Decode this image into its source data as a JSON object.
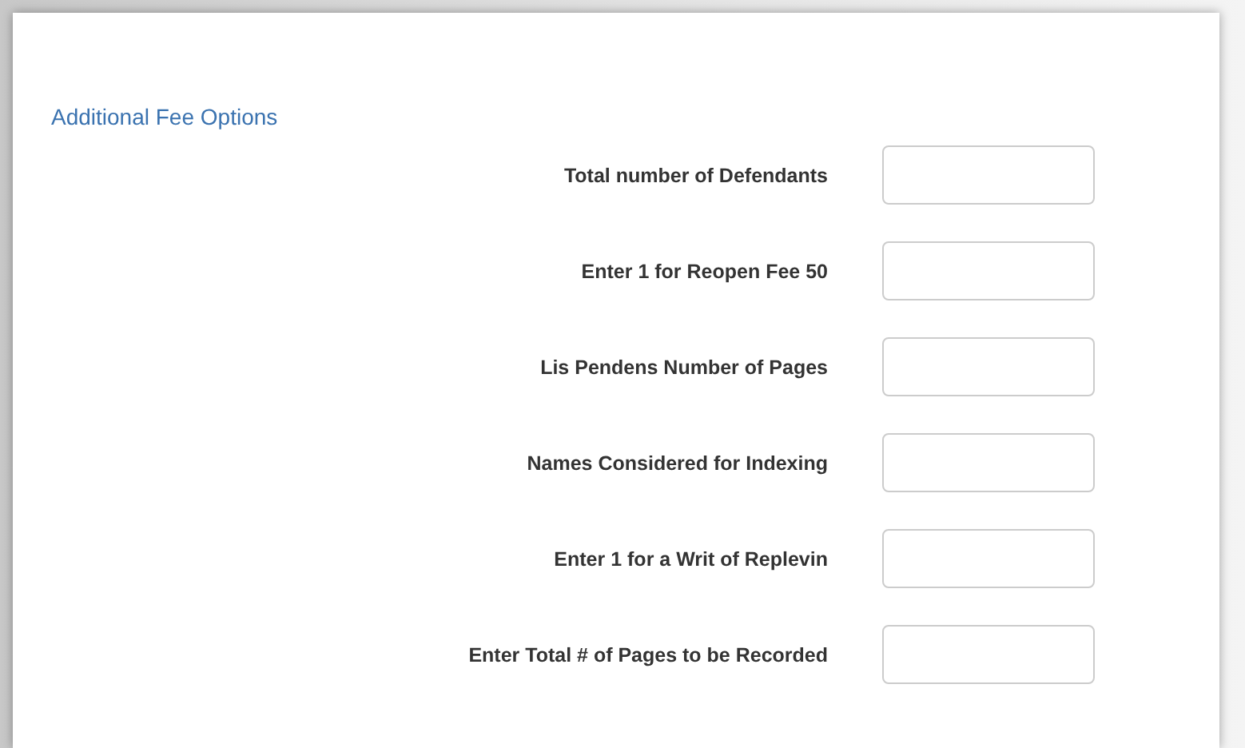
{
  "section": {
    "title": "Additional Fee Options"
  },
  "fields": [
    {
      "label": "Total number of Defendants"
    },
    {
      "label": "Enter 1 for Reopen Fee 50"
    },
    {
      "label": "Lis Pendens Number of Pages"
    },
    {
      "label": "Names Considered for Indexing"
    },
    {
      "label": "Enter 1 for a Writ of Replevin"
    },
    {
      "label": "Enter Total # of Pages to be Recorded"
    }
  ]
}
